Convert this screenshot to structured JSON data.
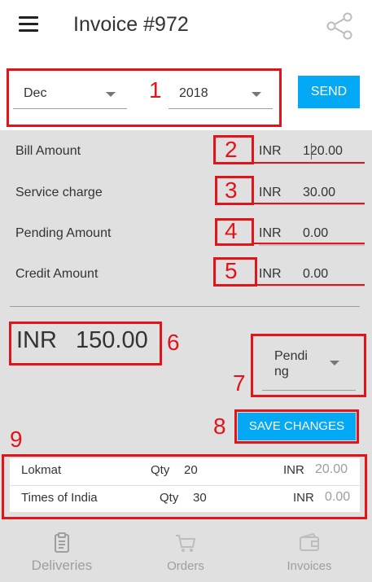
{
  "header": {
    "title": "Invoice #972"
  },
  "selection": {
    "month": "Dec",
    "year": "2018",
    "send_label": "SEND"
  },
  "bill_rows": [
    {
      "label": "Bill Amount",
      "currency": "INR",
      "value": "120.00"
    },
    {
      "label": "Service charge",
      "currency": "INR",
      "value": "30.00"
    },
    {
      "label": "Pending Amount",
      "currency": "INR",
      "value": "0.00"
    },
    {
      "label": "Credit Amount",
      "currency": "INR",
      "value": "0.00"
    }
  ],
  "total": {
    "currency": "INR",
    "value": "150.00"
  },
  "status": {
    "value": "Pending"
  },
  "save_label": "SAVE CHANGES",
  "items": [
    {
      "name": "Lokmat",
      "qty_label": "Qty",
      "qty": "20",
      "currency": "INR",
      "amount": "20.00"
    },
    {
      "name": "Times of India",
      "qty_label": "Qty",
      "qty": "30",
      "currency": "INR",
      "amount": "0.00"
    }
  ],
  "bottom_nav": [
    {
      "label": "Deliveries",
      "icon": "clipboard-icon",
      "active": true
    },
    {
      "label": "Orders",
      "icon": "cart-icon",
      "active": false
    },
    {
      "label": "Invoices",
      "icon": "wallet-icon",
      "active": false
    }
  ],
  "annotations": [
    "1",
    "2",
    "3",
    "4",
    "5",
    "6",
    "7",
    "8",
    "9"
  ],
  "colors": {
    "accent": "#03a9f4",
    "panel": "#e0e0e0",
    "annotation": "#e3131a"
  }
}
